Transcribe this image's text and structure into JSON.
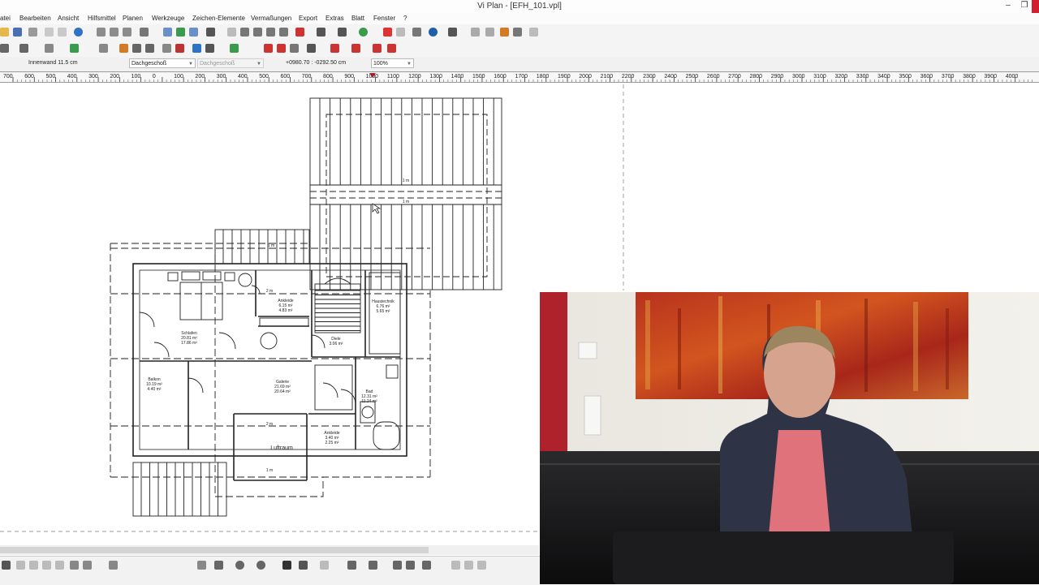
{
  "window": {
    "title": "Vi Plan - [EFH_101.vpl]"
  },
  "menu": [
    "atei",
    "Bearbeiten",
    "Ansicht",
    "Hilfsmittel",
    "Planen",
    "Werkzeuge",
    "Zeichen-Elemente",
    "Vermaßungen",
    "Export",
    "Extras",
    "Blatt",
    "Fenster",
    "?"
  ],
  "properties": {
    "element": "Innenwand 11.5 cm",
    "floor": "Dachgeschoß",
    "floor2": "Dachgeschoß",
    "coordinates": "+0980.70 : -0292.50 cm",
    "zoom": "100%"
  },
  "ruler": [
    "700",
    "600",
    "500",
    "400",
    "300",
    "200",
    "100",
    "0",
    "100",
    "200",
    "300",
    "400",
    "500",
    "600",
    "700",
    "800",
    "900",
    "1000",
    "1100",
    "1200",
    "1300",
    "1400",
    "1500",
    "1600",
    "1700",
    "1800",
    "1900",
    "2000",
    "2100",
    "2200",
    "2300",
    "2400",
    "2500",
    "2600",
    "2700",
    "2800",
    "2900",
    "3000",
    "3100",
    "3200",
    "3300",
    "3400",
    "3500",
    "3600",
    "3700",
    "3800",
    "3900",
    "4000"
  ],
  "plan": {
    "rooms": [
      {
        "name": "Schlafen",
        "a": "20.81 m²",
        "b": "17.86 m²"
      },
      {
        "name": "Ankleide",
        "a": "6.15 m²",
        "b": "4.83 m²"
      },
      {
        "name": "Haustechnik",
        "a": "6.76 m²",
        "b": "5.65 m²"
      },
      {
        "name": "Diele",
        "a": "3.06 m²"
      },
      {
        "name": "Balkon",
        "a": "10.19 m²",
        "b": "4.40 m²"
      },
      {
        "name": "Galerie",
        "a": "21.69 m²",
        "b": "20.64 m²"
      },
      {
        "name": "Bad",
        "a": "12.31 m²",
        "b": "11.24 m²"
      },
      {
        "name": "Ankleide",
        "a": "3.40 m²",
        "b": "2.25 m²"
      },
      {
        "name": "Luftraum"
      }
    ],
    "dims": [
      "1 m",
      "1 m",
      "1 m",
      "2 m",
      "2 m",
      "1 m"
    ]
  },
  "colors": {
    "accent": "#d21e2f",
    "lines": "#222222",
    "ruler_marker": "#d21e2f"
  }
}
